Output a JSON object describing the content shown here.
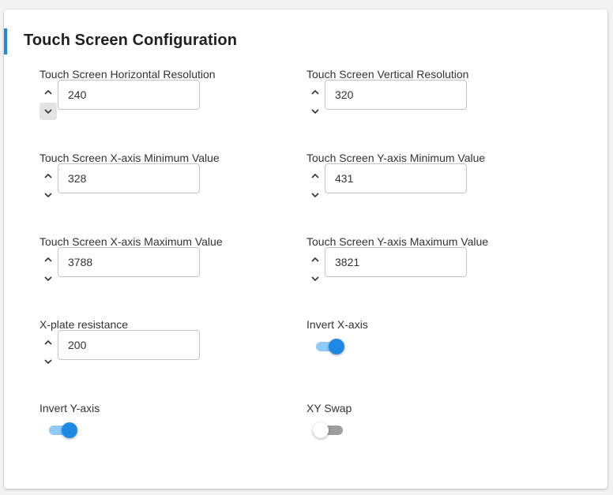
{
  "card": {
    "title": "Touch Screen Configuration"
  },
  "fields": {
    "h_resolution": {
      "label": "Touch Screen Horizontal Resolution",
      "value": "240"
    },
    "v_resolution": {
      "label": "Touch Screen Vertical Resolution",
      "value": "320"
    },
    "x_min": {
      "label": "Touch Screen X-axis Minimum Value",
      "value": "328"
    },
    "y_min": {
      "label": "Touch Screen Y-axis Minimum Value",
      "value": "431"
    },
    "x_max": {
      "label": "Touch Screen X-axis Maximum Value",
      "value": "3788"
    },
    "y_max": {
      "label": "Touch Screen Y-axis Maximum Value",
      "value": "3821"
    },
    "x_plate": {
      "label": "X-plate resistance",
      "value": "200"
    }
  },
  "toggles": {
    "invert_x": {
      "label": "Invert X-axis",
      "checked": true
    },
    "invert_y": {
      "label": "Invert Y-axis",
      "checked": true
    },
    "xy_swap": {
      "label": "XY Swap",
      "checked": false
    }
  },
  "icons": {
    "up": "chevron-up-icon",
    "down": "chevron-down-icon"
  },
  "colors": {
    "accent": "#1e88e5",
    "toggle_track_on": "#90caf9",
    "toggle_track_off": "#9e9e9e",
    "input_border": "#c4c4c4"
  }
}
